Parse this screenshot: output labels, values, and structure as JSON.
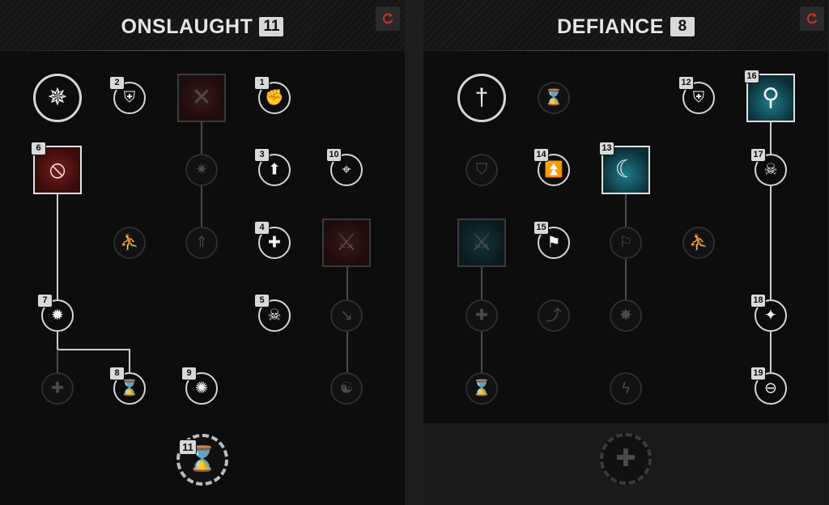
{
  "trees": [
    {
      "id": "left",
      "title": "ONSLAUGHT",
      "points": "11",
      "reset_icon": "refresh-icon",
      "nodes": [
        {
          "name": "onslaught-core-node",
          "icon": "sword-burst-icon",
          "glyph": "✵",
          "shape": "lg",
          "active": true,
          "label": ""
        },
        {
          "name": "node-2",
          "icon": "shield-strike-icon",
          "glyph": "⛨",
          "shape": "sm",
          "active": true,
          "label": "2"
        },
        {
          "name": "node-claw-capstone",
          "icon": "claw-icon",
          "glyph": "✕",
          "shape": "sq",
          "color": "red",
          "active": false,
          "label": ""
        },
        {
          "name": "node-1",
          "icon": "gauntlet-icon",
          "glyph": "✊",
          "shape": "sm",
          "active": true,
          "label": "1"
        },
        {
          "name": "node-6",
          "icon": "slash-icon",
          "glyph": "⦸",
          "shape": "sq",
          "color": "red",
          "active": true,
          "label": "6"
        },
        {
          "name": "node-spike-burst",
          "icon": "spike-burst-icon",
          "glyph": "✷",
          "shape": "sm",
          "active": false,
          "label": ""
        },
        {
          "name": "node-3",
          "icon": "boot-arrow-icon",
          "glyph": "⬆",
          "shape": "sm",
          "active": true,
          "label": "3"
        },
        {
          "name": "node-10",
          "icon": "crosshair-icon",
          "glyph": "⌖",
          "shape": "sm",
          "active": true,
          "label": "10"
        },
        {
          "name": "node-sprint",
          "icon": "sprint-icon",
          "glyph": "⛹",
          "shape": "sm",
          "active": false,
          "label": ""
        },
        {
          "name": "node-blade-up",
          "icon": "blade-up-icon",
          "glyph": "⇑",
          "shape": "sm",
          "active": false,
          "label": ""
        },
        {
          "name": "node-4",
          "icon": "medic-cross-icon",
          "glyph": "✚",
          "shape": "sm",
          "active": true,
          "label": "4"
        },
        {
          "name": "node-blade-capstone",
          "icon": "blade-wound-icon",
          "glyph": "⚔",
          "shape": "sq",
          "color": "red",
          "active": false,
          "label": ""
        },
        {
          "name": "node-7",
          "icon": "fist-burst-icon",
          "glyph": "✹",
          "shape": "sm",
          "active": true,
          "label": "7"
        },
        {
          "name": "node-5",
          "icon": "skull-icon",
          "glyph": "☠",
          "shape": "sm",
          "active": true,
          "label": "5"
        },
        {
          "name": "node-slam",
          "icon": "slam-icon",
          "glyph": "↘",
          "shape": "sm",
          "active": false,
          "label": ""
        },
        {
          "name": "node-heal-plus",
          "icon": "heal-plus-icon",
          "glyph": "✚",
          "shape": "sm",
          "active": false,
          "label": ""
        },
        {
          "name": "node-8",
          "icon": "hourglass-strike-icon",
          "glyph": "⌛",
          "shape": "sm",
          "active": true,
          "label": "8"
        },
        {
          "name": "node-9",
          "icon": "punch-burst-icon",
          "glyph": "✺",
          "shape": "sm",
          "active": true,
          "label": "9"
        },
        {
          "name": "node-howl",
          "icon": "howl-icon",
          "glyph": "☯",
          "shape": "sm",
          "active": false,
          "label": ""
        },
        {
          "name": "node-11",
          "icon": "hourglass-down-icon",
          "glyph": "⌛",
          "shape": "big",
          "active": true,
          "label": "11"
        }
      ]
    },
    {
      "id": "right",
      "title": "DEFIANCE",
      "points": "8",
      "reset_icon": "refresh-icon",
      "nodes": [
        {
          "name": "defiance-core-node",
          "icon": "sword-ring-icon",
          "glyph": "†",
          "shape": "lg",
          "active": true,
          "label": ""
        },
        {
          "name": "node-hourglass",
          "icon": "hourglass-icon",
          "glyph": "⌛",
          "shape": "sm",
          "active": false,
          "label": ""
        },
        {
          "name": "node-12",
          "icon": "shield-plus-icon",
          "glyph": "⛨",
          "shape": "sm",
          "active": true,
          "label": "12"
        },
        {
          "name": "node-16",
          "icon": "sword-splash-icon",
          "glyph": "⚲",
          "shape": "sq",
          "color": "teal",
          "active": true,
          "label": "16"
        },
        {
          "name": "node-shield-up",
          "icon": "shield-up-icon",
          "glyph": "⛉",
          "shape": "sm",
          "active": false,
          "label": ""
        },
        {
          "name": "node-14",
          "icon": "chevrons-up-icon",
          "glyph": "⏫",
          "shape": "sm",
          "active": true,
          "label": "14"
        },
        {
          "name": "node-13",
          "icon": "crescent-shield-icon",
          "glyph": "☾",
          "shape": "sq",
          "color": "teal",
          "active": true,
          "label": "13"
        },
        {
          "name": "node-17",
          "icon": "skull-shatter-icon",
          "glyph": "☠",
          "shape": "sm",
          "active": true,
          "label": "17"
        },
        {
          "name": "node-grapple-capstone",
          "icon": "grapple-icon",
          "glyph": "⚔",
          "shape": "sq",
          "color": "teal",
          "active": false,
          "label": ""
        },
        {
          "name": "node-15",
          "icon": "banner-strike-icon",
          "glyph": "⚑",
          "shape": "sm",
          "active": true,
          "label": "15"
        },
        {
          "name": "node-banner",
          "icon": "banner-icon",
          "glyph": "⚐",
          "shape": "sm",
          "active": false,
          "label": ""
        },
        {
          "name": "node-sprint-r",
          "icon": "sprint-icon",
          "glyph": "⛹",
          "shape": "sm",
          "active": false,
          "label": ""
        },
        {
          "name": "node-skull-plus",
          "icon": "skull-plus-icon",
          "glyph": "✚",
          "shape": "sm",
          "active": false,
          "label": ""
        },
        {
          "name": "node-sword-arc",
          "icon": "sword-arc-icon",
          "glyph": "⤴",
          "shape": "sm",
          "active": false,
          "label": ""
        },
        {
          "name": "node-sun-burst",
          "icon": "sun-burst-icon",
          "glyph": "✸",
          "shape": "sm",
          "active": false,
          "label": ""
        },
        {
          "name": "node-18",
          "icon": "warrior-burst-icon",
          "glyph": "✦",
          "shape": "sm",
          "active": true,
          "label": "18"
        },
        {
          "name": "node-hourglass-down",
          "icon": "hourglass-down-icon",
          "glyph": "⌛",
          "shape": "sm",
          "active": false,
          "label": ""
        },
        {
          "name": "node-bolt-plus",
          "icon": "bolt-plus-icon",
          "glyph": "ϟ",
          "shape": "sm",
          "active": false,
          "label": ""
        },
        {
          "name": "node-19",
          "icon": "ring-bar-icon",
          "glyph": "⊖",
          "shape": "sm",
          "active": true,
          "label": "19"
        },
        {
          "name": "node-capstone-plus",
          "icon": "cross-icon",
          "glyph": "✚",
          "shape": "big",
          "active": false,
          "label": ""
        }
      ]
    }
  ]
}
